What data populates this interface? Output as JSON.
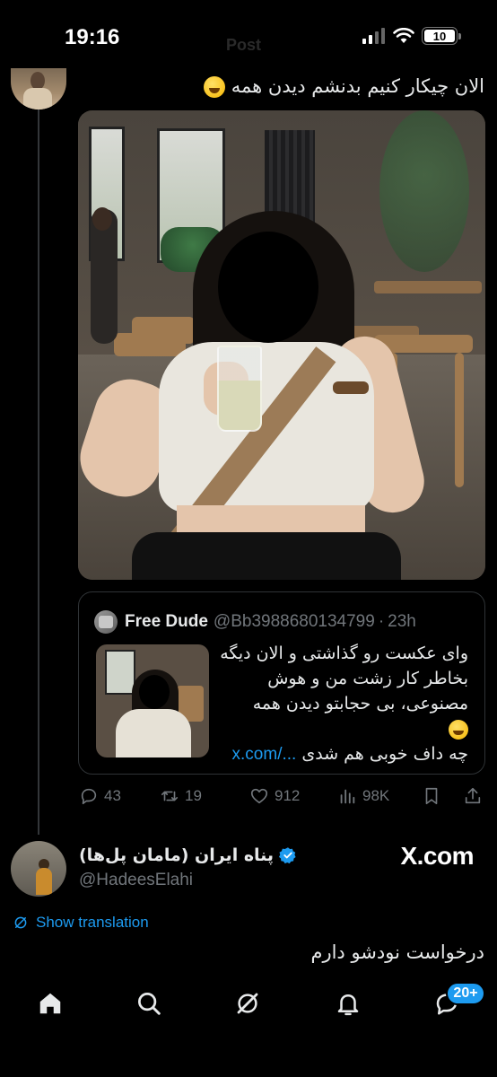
{
  "status_bar": {
    "time": "19:16",
    "ghost_title": "Post",
    "battery": "10"
  },
  "tweet": {
    "text": "الان چیکار کنیم بدنشم دیدن همه"
  },
  "quote": {
    "name": "Free Dude",
    "handle": "@Bb3988680134799",
    "dot": "·",
    "time": "23h",
    "lines": [
      "وای عکست رو گذاشتی و الان دیگه",
      "بخاطر کار زشت من و هوش",
      "مصنوعی، بی حجابتو دیدن همه"
    ],
    "last_line": "چه داف خوبی هم شدی",
    "more": "x.com/..."
  },
  "actions": {
    "replies": "43",
    "reposts": "19",
    "likes": "912",
    "views": "98K"
  },
  "tweet2": {
    "name": "پناه ایران (مامان پل‌ها)",
    "handle": "@HadeesElahi",
    "source": "X.com",
    "translate": "Show translation",
    "text": "درخواست نودشو دارم"
  },
  "nav": {
    "badge": "20+"
  },
  "colors": {
    "accent": "#1d9bf0",
    "background": "#000000",
    "muted": "#71767b"
  }
}
